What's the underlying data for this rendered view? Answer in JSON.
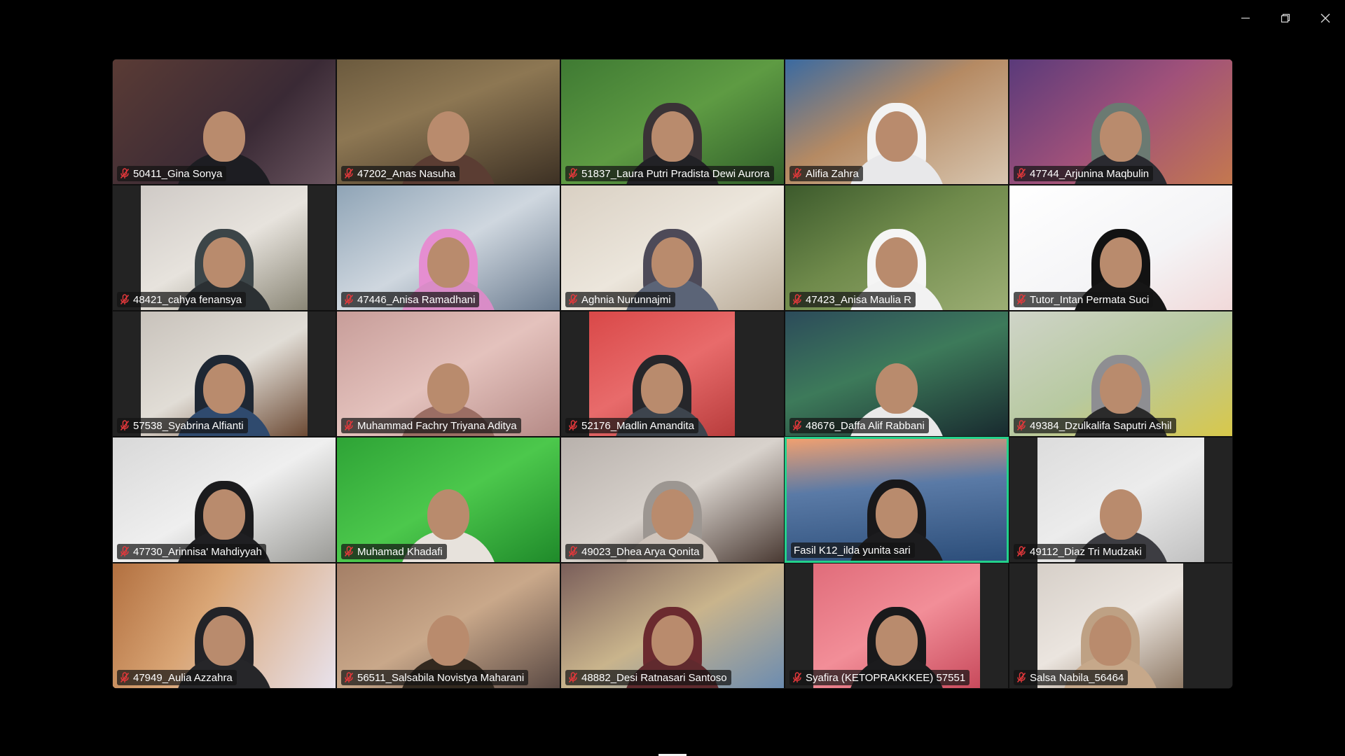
{
  "window_controls": {
    "minimize": "minimize-icon",
    "restore": "restore-icon",
    "close": "close-icon"
  },
  "colors": {
    "background": "#000000",
    "active_speaker_border": "#23d18b",
    "muted_icon": "#e5383b",
    "nameplate_text": "#ffffff"
  },
  "participants": [
    {
      "name": "50411_Gina Sonya",
      "muted": true
    },
    {
      "name": "47202_Anas Nasuha",
      "muted": true
    },
    {
      "name": "51837_Laura Putri Pradista Dewi Aurora",
      "muted": true
    },
    {
      "name": "Alifia Zahra",
      "muted": true
    },
    {
      "name": "47744_Arjunina Maqbulin",
      "muted": true
    },
    {
      "name": "48421_cahya fenansya",
      "muted": true
    },
    {
      "name": "47446_Anisa Ramadhani",
      "muted": true
    },
    {
      "name": "Aghnia Nurunnajmi",
      "muted": true
    },
    {
      "name": "47423_Anisa Maulia R",
      "muted": true
    },
    {
      "name": "Tutor_Intan Permata Suci",
      "muted": true
    },
    {
      "name": "57538_Syabrina Alfianti",
      "muted": true
    },
    {
      "name": "Muhammad Fachry Triyana Aditya",
      "muted": true
    },
    {
      "name": "52176_Madlin Amandita",
      "muted": true
    },
    {
      "name": "48676_Daffa Alif Rabbani",
      "muted": true
    },
    {
      "name": "49384_Dzulkalifa Saputri Ashil",
      "muted": true
    },
    {
      "name": "47730_Arinnisa' Mahdiyyah",
      "muted": true
    },
    {
      "name": "Muhamad Khadafi",
      "muted": true
    },
    {
      "name": "49023_Dhea Arya Qonita",
      "muted": true
    },
    {
      "name": "Fasil K12_ilda yunita sari",
      "muted": false,
      "active_speaker": true
    },
    {
      "name": "49112_Diaz Tri Mudzaki",
      "muted": true
    },
    {
      "name": "47949_Aulia Azzahra",
      "muted": true
    },
    {
      "name": "56511_Salsabila Novistya Maharani",
      "muted": true
    },
    {
      "name": "48882_Desi Ratnasari Santoso",
      "muted": true
    },
    {
      "name": "Syafira (KETOPRAKKKEE) 57551",
      "muted": true
    },
    {
      "name": "Salsa Nabila_56464",
      "muted": true
    }
  ]
}
